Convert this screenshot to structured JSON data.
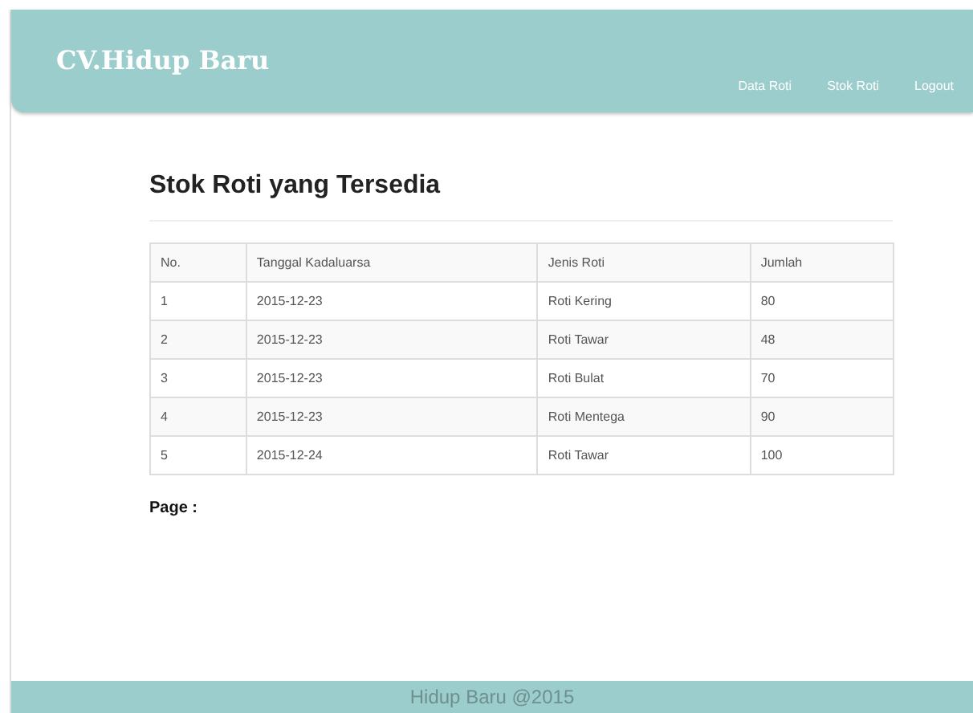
{
  "header": {
    "brand": "CV.Hidup Baru",
    "nav": [
      {
        "label": "Data Roti"
      },
      {
        "label": "Stok Roti"
      },
      {
        "label": "Logout"
      }
    ]
  },
  "title": "Stok Roti yang Tersedia",
  "table": {
    "columns": [
      "No.",
      "Tanggal Kadaluarsa",
      "Jenis Roti",
      "Jumlah"
    ],
    "rows": [
      [
        "1",
        "2015-12-23",
        "Roti Kering",
        "80"
      ],
      [
        "2",
        "2015-12-23",
        "Roti Tawar",
        "48"
      ],
      [
        "3",
        "2015-12-23",
        "Roti Bulat",
        "70"
      ],
      [
        "4",
        "2015-12-23",
        "Roti Mentega",
        "90"
      ],
      [
        "5",
        "2015-12-24",
        "Roti Tawar",
        "100"
      ]
    ]
  },
  "pager_label": "Page :",
  "footer": "Hidup Baru @2015"
}
